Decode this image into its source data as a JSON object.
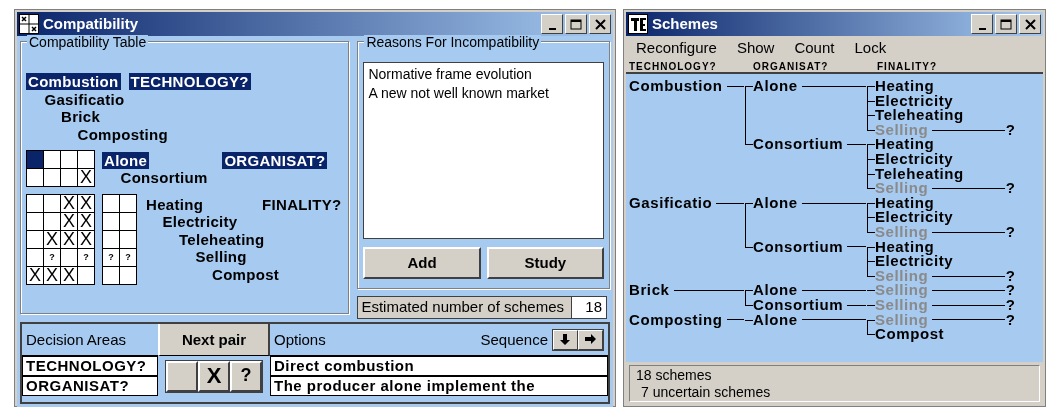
{
  "compatibility_window": {
    "title": "Compatibility",
    "compatibility_table": {
      "title": "Compatibility Table",
      "factors": [
        {
          "name": "TECHNOLOGY?",
          "selected": true,
          "options": [
            {
              "label": "Combustion",
              "selected": true
            },
            {
              "label": "Gasificatio",
              "selected": false
            },
            {
              "label": "Brick",
              "selected": false
            },
            {
              "label": "Composting",
              "selected": false
            }
          ]
        },
        {
          "name": "ORGANISAT?",
          "selected": true,
          "options": [
            {
              "label": "Alone",
              "selected": true
            },
            {
              "label": "Consortium",
              "selected": false
            }
          ],
          "grids": [
            {
              "rows": [
                [
                  {
                    "selected": true
                  },
                  {
                    "selected": false
                  },
                  {
                    "selected": false
                  },
                  {
                    "selected": false
                  }
                ],
                [
                  {
                    "selected": false
                  },
                  {
                    "selected": false
                  },
                  {
                    "selected": false
                  },
                  {
                    "selected": false,
                    "mark": "X"
                  }
                ]
              ]
            }
          ]
        },
        {
          "name": "FINALITY?",
          "selected": false,
          "options": [
            {
              "label": "Heating",
              "selected": false
            },
            {
              "label": "Electricity",
              "selected": false
            },
            {
              "label": "Teleheating",
              "selected": false
            },
            {
              "label": "Selling",
              "selected": false
            },
            {
              "label": "Compost",
              "selected": false
            }
          ],
          "grids": [
            {
              "rows": [
                [
                  {
                    "selected": false
                  },
                  {
                    "selected": false
                  },
                  {
                    "selected": false,
                    "mark": "X"
                  },
                  {
                    "selected": false,
                    "mark": "X"
                  }
                ],
                [
                  {
                    "selected": false
                  },
                  {
                    "selected": false
                  },
                  {
                    "selected": false,
                    "mark": "X"
                  },
                  {
                    "selected": false,
                    "mark": "X"
                  }
                ],
                [
                  {
                    "selected": false
                  },
                  {
                    "selected": false,
                    "mark": "X"
                  },
                  {
                    "selected": false,
                    "mark": "X"
                  },
                  {
                    "selected": false,
                    "mark": "X"
                  }
                ],
                [
                  {
                    "selected": false
                  },
                  {
                    "selected": false,
                    "mark": "?"
                  },
                  {
                    "selected": false
                  },
                  {
                    "selected": false,
                    "mark": "?"
                  }
                ],
                [
                  {
                    "selected": false,
                    "mark": "X"
                  },
                  {
                    "selected": false,
                    "mark": "X"
                  },
                  {
                    "selected": false,
                    "mark": "X"
                  },
                  {
                    "selected": false
                  }
                ]
              ]
            },
            {
              "rows": [
                [
                  {
                    "selected": false
                  },
                  {
                    "selected": false
                  }
                ],
                [
                  {
                    "selected": false
                  },
                  {
                    "selected": false
                  }
                ],
                [
                  {
                    "selected": false
                  },
                  {
                    "selected": false
                  }
                ],
                [
                  {
                    "selected": false,
                    "mark": "?"
                  },
                  {
                    "selected": false,
                    "mark": "?"
                  }
                ],
                [
                  {
                    "selected": false
                  },
                  {
                    "selected": false
                  }
                ]
              ]
            }
          ]
        }
      ]
    },
    "reasons": {
      "title": "Reasons For Incompatibility",
      "items": [
        "Normative frame evolution",
        "A new not well known market"
      ],
      "buttons": [
        "Add",
        "Study"
      ]
    },
    "estimate": {
      "label": "Estimated number of schemes",
      "value": "18"
    },
    "decision_panel": {
      "areas_label": "Decision Areas",
      "next_pair": "Next pair",
      "options_label": "Options",
      "sequence_label": "Sequence",
      "sequence_buttons": [
        {
          "kind": "down"
        },
        {
          "kind": "right"
        }
      ],
      "rows": [
        {
          "area": "TECHNOLOGY?",
          "option": "Direct combustion"
        },
        {
          "area": "ORGANISAT?",
          "option": "The producer alone implement the"
        }
      ],
      "answer_buttons": [
        {
          "kind": "blank"
        },
        {
          "kind": "cross",
          "label": "X"
        },
        {
          "kind": "uncertain",
          "label": "?"
        }
      ]
    }
  },
  "schemes_window": {
    "title": "Schemes",
    "menu": [
      "Reconfigure",
      "Show",
      "Count",
      "Lock"
    ],
    "columns": [
      "TECHNOLOGY?",
      "ORGANISAT?",
      "FINALITY?"
    ],
    "tree": [
      {
        "label": "Combustion",
        "children": [
          {
            "label": "Alone",
            "children": [
              {
                "label": "Heating",
                "uncertain": false
              },
              {
                "label": "Electricity",
                "uncertain": false
              },
              {
                "label": "Teleheating",
                "uncertain": false
              },
              {
                "label": "Selling",
                "uncertain": true,
                "result": "?"
              }
            ]
          },
          {
            "label": "Consortium",
            "children": [
              {
                "label": "Heating",
                "uncertain": false
              },
              {
                "label": "Electricity",
                "uncertain": false
              },
              {
                "label": "Teleheating",
                "uncertain": false
              },
              {
                "label": "Selling",
                "uncertain": true,
                "result": "?"
              }
            ]
          }
        ]
      },
      {
        "label": "Gasificatio",
        "children": [
          {
            "label": "Alone",
            "children": [
              {
                "label": "Heating",
                "uncertain": false
              },
              {
                "label": "Electricity",
                "uncertain": false
              },
              {
                "label": "Selling",
                "uncertain": true,
                "result": "?"
              }
            ]
          },
          {
            "label": "Consortium",
            "children": [
              {
                "label": "Heating",
                "uncertain": false
              },
              {
                "label": "Electricity",
                "uncertain": false
              },
              {
                "label": "Selling",
                "uncertain": true,
                "result": "?"
              }
            ]
          }
        ]
      },
      {
        "label": "Brick",
        "children": [
          {
            "label": "Alone",
            "children": [
              {
                "label": "Selling",
                "uncertain": true,
                "result": "?"
              }
            ]
          },
          {
            "label": "Consortium",
            "children": [
              {
                "label": "Selling",
                "uncertain": true,
                "result": "?"
              }
            ]
          }
        ]
      },
      {
        "label": "Composting",
        "children": [
          {
            "label": "Alone",
            "children": [
              {
                "label": "Selling",
                "uncertain": true,
                "result": "?"
              },
              {
                "label": "Compost",
                "uncertain": false
              }
            ]
          }
        ]
      }
    ],
    "status": [
      "18 schemes",
      "7 uncertain schemes"
    ]
  }
}
